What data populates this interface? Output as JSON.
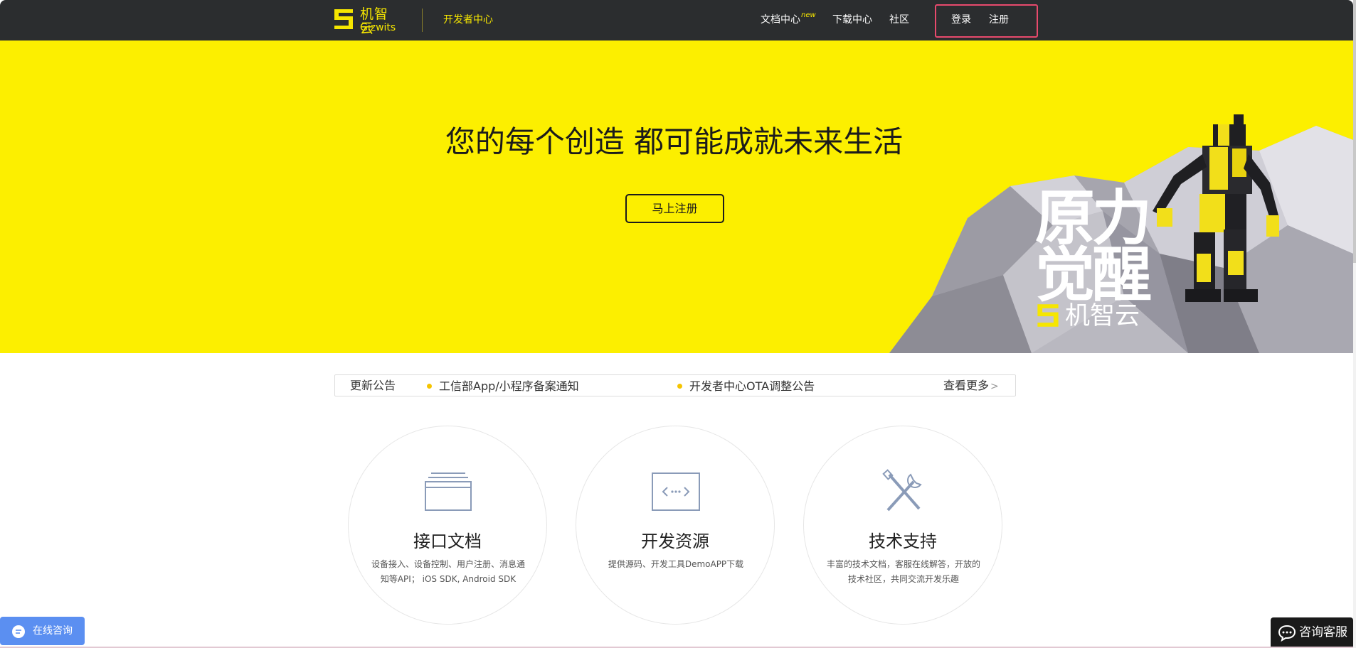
{
  "header": {
    "logo_cn": "机智云",
    "logo_en": "Gizwits",
    "developer_center": "开发者中心",
    "nav": {
      "docs": "文档中心",
      "docs_badge": "new",
      "download": "下载中心",
      "community": "社区",
      "login": "登录",
      "register": "注册"
    }
  },
  "banner": {
    "headline": "您的每个创造 都可能成就未来生活",
    "cta_label": "马上注册",
    "art_title_line1": "原力",
    "art_title_line2": "觉醒",
    "art_brand": "机智云",
    "background_color": "#fcef00"
  },
  "notice": {
    "title": "更新公告",
    "items": [
      "工信部App/小程序备案通知",
      "开发者中心OTA调整公告"
    ],
    "more": "查看更多",
    "more_icon": "chevron-right-icon"
  },
  "features": [
    {
      "title": "接口文档",
      "desc": "设备接入、设备控制、用户注册、消息通知等API； iOS SDK, Android SDK",
      "icon": "document-stack-icon"
    },
    {
      "title": "开发资源",
      "desc": "提供源码、开发工具DemoAPP下载",
      "icon": "code-window-icon"
    },
    {
      "title": "技术支持",
      "desc": "丰富的技术文档，客服在线解答，开放的技术社区，共同交流开发乐趣",
      "icon": "tools-icon"
    }
  ],
  "floating": {
    "online_chat": "在线咨询",
    "service": "咨询客服"
  },
  "colors": {
    "accent": "#f6e600",
    "header_bg": "#2b2d2f",
    "chat_blue": "#5b8ff1",
    "highlight_box": "#e84a6d"
  }
}
